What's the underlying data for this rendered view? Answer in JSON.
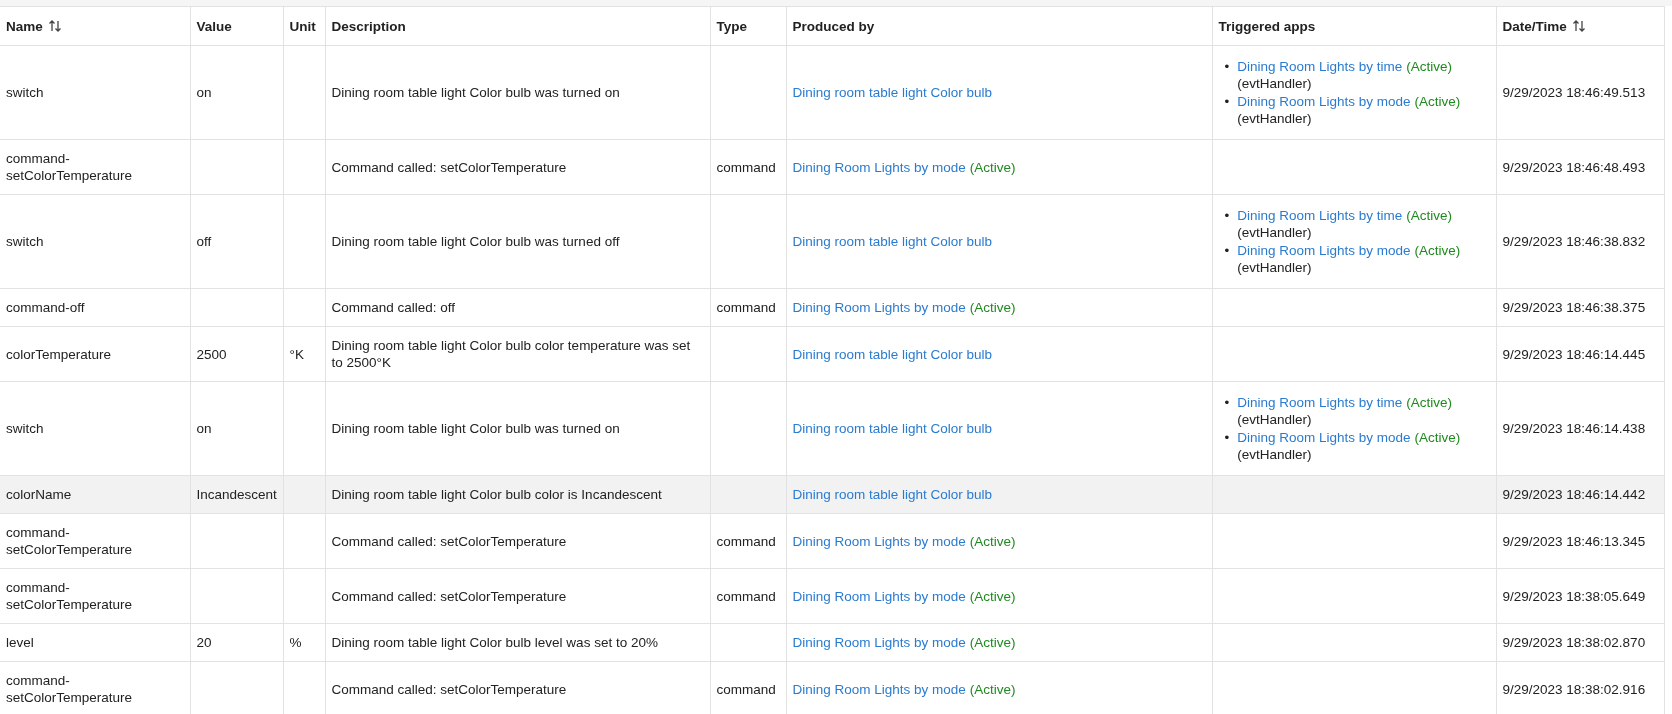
{
  "table": {
    "columns": [
      {
        "label": "Name",
        "sortable": true
      },
      {
        "label": "Value",
        "sortable": false
      },
      {
        "label": "Unit",
        "sortable": false
      },
      {
        "label": "Description",
        "sortable": false
      },
      {
        "label": "Type",
        "sortable": false
      },
      {
        "label": "Produced by",
        "sortable": false
      },
      {
        "label": "Triggered apps",
        "sortable": false
      },
      {
        "label": "Date/Time",
        "sortable": true
      }
    ],
    "rows": [
      {
        "name": "switch",
        "value": "on",
        "unit": "",
        "description": "Dining room table light Color bulb was turned on",
        "type": "",
        "produced_by": {
          "app": "Dining room table light Color bulb"
        },
        "triggered_apps": [
          {
            "bullet": "•",
            "app": "Dining Room Lights by time",
            "status": "(Active)",
            "handler": "(evtHandler)"
          },
          {
            "bullet": "•",
            "app": "Dining Room Lights by mode",
            "status": "(Active)",
            "handler": "(evtHandler)"
          }
        ],
        "datetime": "9/29/2023 18:46:49.513",
        "highlighted": false
      },
      {
        "name": "command-setColorTemperature",
        "value": "",
        "unit": "",
        "description": "Command called: setColorTemperature",
        "type": "command",
        "produced_by": {
          "app": "Dining Room Lights by mode",
          "status": "(Active)"
        },
        "triggered_apps": [],
        "datetime": "9/29/2023 18:46:48.493",
        "highlighted": false
      },
      {
        "name": "switch",
        "value": "off",
        "unit": "",
        "description": "Dining room table light Color bulb was turned off",
        "type": "",
        "produced_by": {
          "app": "Dining room table light Color bulb"
        },
        "triggered_apps": [
          {
            "bullet": "•",
            "app": "Dining Room Lights by time",
            "status": "(Active)",
            "handler": "(evtHandler)"
          },
          {
            "bullet": "•",
            "app": "Dining Room Lights by mode",
            "status": "(Active)",
            "handler": "(evtHandler)"
          }
        ],
        "datetime": "9/29/2023 18:46:38.832",
        "highlighted": false
      },
      {
        "name": "command-off",
        "value": "",
        "unit": "",
        "description": "Command called: off",
        "type": "command",
        "produced_by": {
          "app": "Dining Room Lights by mode",
          "status": "(Active)"
        },
        "triggered_apps": [],
        "datetime": "9/29/2023 18:46:38.375",
        "highlighted": false
      },
      {
        "name": "colorTemperature",
        "value": "2500",
        "unit": "°K",
        "description": "Dining room table light Color bulb color temperature was set to 2500°K",
        "type": "",
        "produced_by": {
          "app": "Dining room table light Color bulb"
        },
        "triggered_apps": [],
        "datetime": "9/29/2023 18:46:14.445",
        "highlighted": false
      },
      {
        "name": "switch",
        "value": "on",
        "unit": "",
        "description": "Dining room table light Color bulb was turned on",
        "type": "",
        "produced_by": {
          "app": "Dining room table light Color bulb"
        },
        "triggered_apps": [
          {
            "bullet": "•",
            "app": "Dining Room Lights by time",
            "status": "(Active)",
            "handler": "(evtHandler)"
          },
          {
            "bullet": "•",
            "app": "Dining Room Lights by mode",
            "status": "(Active)",
            "handler": "(evtHandler)"
          }
        ],
        "datetime": "9/29/2023 18:46:14.438",
        "highlighted": false
      },
      {
        "name": "colorName",
        "value": "Incandescent",
        "unit": "",
        "description": "Dining room table light Color bulb color is Incandescent",
        "type": "",
        "produced_by": {
          "app": "Dining room table light Color bulb"
        },
        "triggered_apps": [],
        "datetime": "9/29/2023 18:46:14.442",
        "highlighted": true
      },
      {
        "name": "command-setColorTemperature",
        "value": "",
        "unit": "",
        "description": "Command called: setColorTemperature",
        "type": "command",
        "produced_by": {
          "app": "Dining Room Lights by mode",
          "status": "(Active)"
        },
        "triggered_apps": [],
        "datetime": "9/29/2023 18:46:13.345",
        "highlighted": false
      },
      {
        "name": "command-setColorTemperature",
        "value": "",
        "unit": "",
        "description": "Command called: setColorTemperature",
        "type": "command",
        "produced_by": {
          "app": "Dining Room Lights by mode",
          "status": "(Active)"
        },
        "triggered_apps": [],
        "datetime": "9/29/2023 18:38:05.649",
        "highlighted": false
      },
      {
        "name": "level",
        "value": "20",
        "unit": "%",
        "description": "Dining room table light Color bulb level was set to 20%",
        "type": "",
        "produced_by": {
          "app": "Dining Room Lights by mode",
          "status": "(Active)"
        },
        "triggered_apps": [],
        "datetime": "9/29/2023 18:38:02.870",
        "highlighted": false
      },
      {
        "name": "command-setColorTemperature",
        "value": "",
        "unit": "",
        "description": "Command called: setColorTemperature",
        "type": "command",
        "produced_by": {
          "app": "Dining Room Lights by mode",
          "status": "(Active)"
        },
        "triggered_apps": [],
        "datetime": "9/29/2023 18:38:02.916",
        "highlighted": false
      }
    ]
  }
}
